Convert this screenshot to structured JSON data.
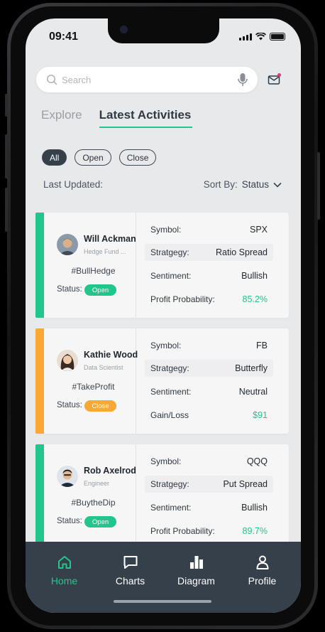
{
  "status_bar": {
    "time": "09:41"
  },
  "search": {
    "placeholder": "Search"
  },
  "tabs": [
    {
      "label": "Explore"
    },
    {
      "label": "Latest Activities"
    }
  ],
  "filters": [
    {
      "label": "All"
    },
    {
      "label": "Open"
    },
    {
      "label": "Close"
    }
  ],
  "updated_label": "Last Updated:",
  "sort": {
    "label": "Sort By:",
    "value": "Status"
  },
  "colors": {
    "accent": "#22c58b",
    "orange": "#f7a835",
    "nav_bg": "#36404b"
  },
  "activities": [
    {
      "name": "Will Ackman",
      "role": "Hedge Fund ...",
      "tag": "#BullHedge",
      "status_label": "Status:",
      "status": "Open",
      "rows": [
        {
          "label": "Symbol:",
          "value": "SPX"
        },
        {
          "label": "Stratgegy:",
          "value": "Ratio Spread"
        },
        {
          "label": "Sentiment:",
          "value": "Bullish"
        },
        {
          "label": "Profit Probability:",
          "value": "85.2%"
        }
      ]
    },
    {
      "name": "Kathie Wood",
      "role": "Data Scientist",
      "tag": "#TakeProfit",
      "status_label": "Status:",
      "status": "Close",
      "rows": [
        {
          "label": "Symbol:",
          "value": "FB"
        },
        {
          "label": "Stratgegy:",
          "value": "Butterfly"
        },
        {
          "label": "Sentiment:",
          "value": "Neutral"
        },
        {
          "label": "Gain/Loss",
          "value": "$91"
        }
      ]
    },
    {
      "name": "Rob Axelrod",
      "role": "Engineer",
      "tag": "#BuytheDip",
      "status_label": "Status:",
      "status": "Open",
      "rows": [
        {
          "label": "Symbol:",
          "value": "QQQ"
        },
        {
          "label": "Stratgegy:",
          "value": "Put Spread"
        },
        {
          "label": "Sentiment:",
          "value": "Bullish"
        },
        {
          "label": "Profit Probability:",
          "value": "89.7%"
        }
      ]
    }
  ],
  "nav": [
    {
      "label": "Home",
      "icon": "home-icon"
    },
    {
      "label": "Charts",
      "icon": "chat-icon"
    },
    {
      "label": "Diagram",
      "icon": "bar-chart-icon"
    },
    {
      "label": "Profile",
      "icon": "user-icon"
    }
  ]
}
